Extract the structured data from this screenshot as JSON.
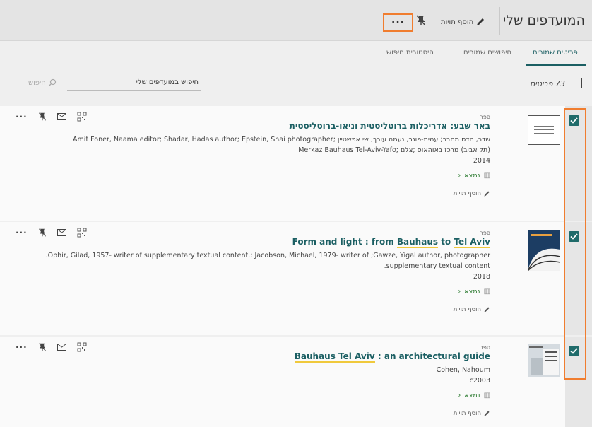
{
  "header": {
    "title": "המועדפים שלי",
    "add_tags_label": "הוסף תויות",
    "more_label": "···"
  },
  "tabs": [
    {
      "label": "פריטים שמורים",
      "active": true
    },
    {
      "label": "חיפושים שמורים",
      "active": false
    },
    {
      "label": "היסטורית חיפוש",
      "active": false
    }
  ],
  "list": {
    "count_text": "73 פריטים",
    "search_value": "חיפוש במועדפים שלי",
    "search_button": "חיפוש"
  },
  "records": [
    {
      "type": "ספר",
      "title": "באר שבע: אדריכלות ברוטליסטית וניאו-ברוטליסטית",
      "authors_line1": "שדר, הדס מחבר; עמית-פונר, נעמה עורך; שי אפשטיין ;Amit Foner, Naama editor; Shadar, Hadas author; Epstein, Shai photographer",
      "authors_line2": "(תל אביב) מרכז באוהאוס ;צלם ;Merkaz Bauhaus Tel-Aviv-Yafo",
      "year": "2014",
      "availability": "נמצא",
      "add_tags": "הוסף תויות",
      "checked": true
    },
    {
      "type": "ספר",
      "title_pre": "Form and light : from ",
      "title_hl1": "Bauhaus",
      "title_mid": " to ",
      "title_hl2": "Tel Aviv",
      "authors_line1": "Ophir, Gilad, 1957- writer of supplementary textual content.; Jacobson, Michael, 1979- writer of ;Gawze, Yigal author, photographer.",
      "authors_line2": "supplementary textual content.",
      "year": "2018",
      "availability": "נמצא",
      "add_tags": "הוסף תויות",
      "checked": true
    },
    {
      "type": "ספר",
      "title_hl1": "Bauhaus Tel Aviv",
      "title_post": " : an architectural guide",
      "authors_line1": "Cohen, Nahoum",
      "year": "c2003",
      "availability": "נמצא",
      "add_tags": "הוסף תויות",
      "checked": true
    }
  ],
  "colors": {
    "accent": "#1b5f63",
    "highlight_box": "#f07d2f",
    "available": "#2a7a2f",
    "search_highlight": "#f0c93c"
  }
}
